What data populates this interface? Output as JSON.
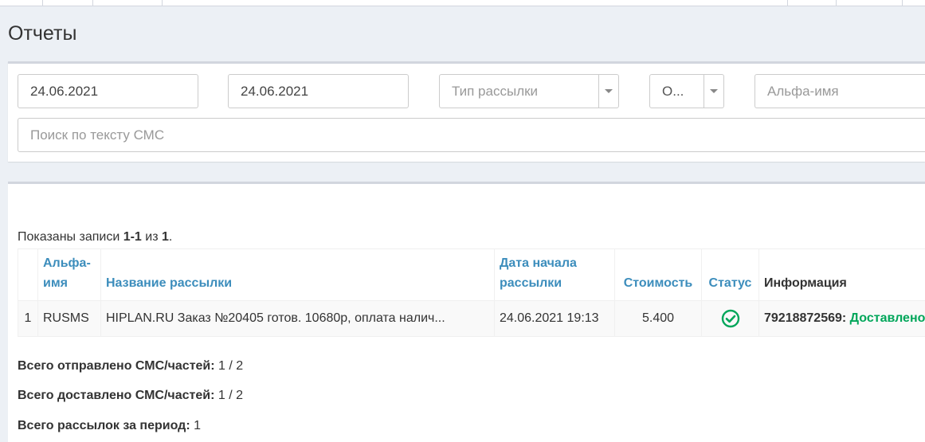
{
  "page": {
    "title": "Отчеты"
  },
  "filters": {
    "date_from": "24.06.2021",
    "date_to": "24.06.2021",
    "mailing_type_placeholder": "Тип рассылки",
    "operator_value": "О...",
    "alpha_name_placeholder": "Альфа-имя",
    "sms_text_search_placeholder": "Поиск по тексту СМС"
  },
  "results": {
    "summary_prefix": "Показаны записи ",
    "summary_range": "1-1",
    "summary_of": " из ",
    "summary_total": "1",
    "summary_suffix": ".",
    "columns": {
      "num": "",
      "alpha_name": "Альфа-имя",
      "mailing_name": "Название рассылки",
      "start_date": "Дата начала рассылки",
      "cost": "Стоимость",
      "status": "Статус",
      "info": "Информация"
    },
    "rows": [
      {
        "num": "1",
        "alpha_name": "RUSMS",
        "mailing_name": "HIPLAN.RU Заказ №20405 готов. 10680р, оплата налич...",
        "start_date": "24.06.2021 19:13",
        "cost": "5.400",
        "status_icon": "check-circle-icon",
        "info_phone": "79218872569",
        "info_sep": ": ",
        "info_status": "Доставлено"
      }
    ]
  },
  "totals": {
    "sent_label": "Всего отправлено СМС/частей:",
    "sent_value": "1 / 2",
    "delivered_label": "Всего доставлено СМС/частей:",
    "delivered_value": "1 / 2",
    "mailings_label": "Всего рассылок за период:",
    "mailings_value": "1"
  },
  "colors": {
    "accent": "#3c8dbc",
    "success": "#00a65a",
    "background": "#ecf0f5"
  }
}
